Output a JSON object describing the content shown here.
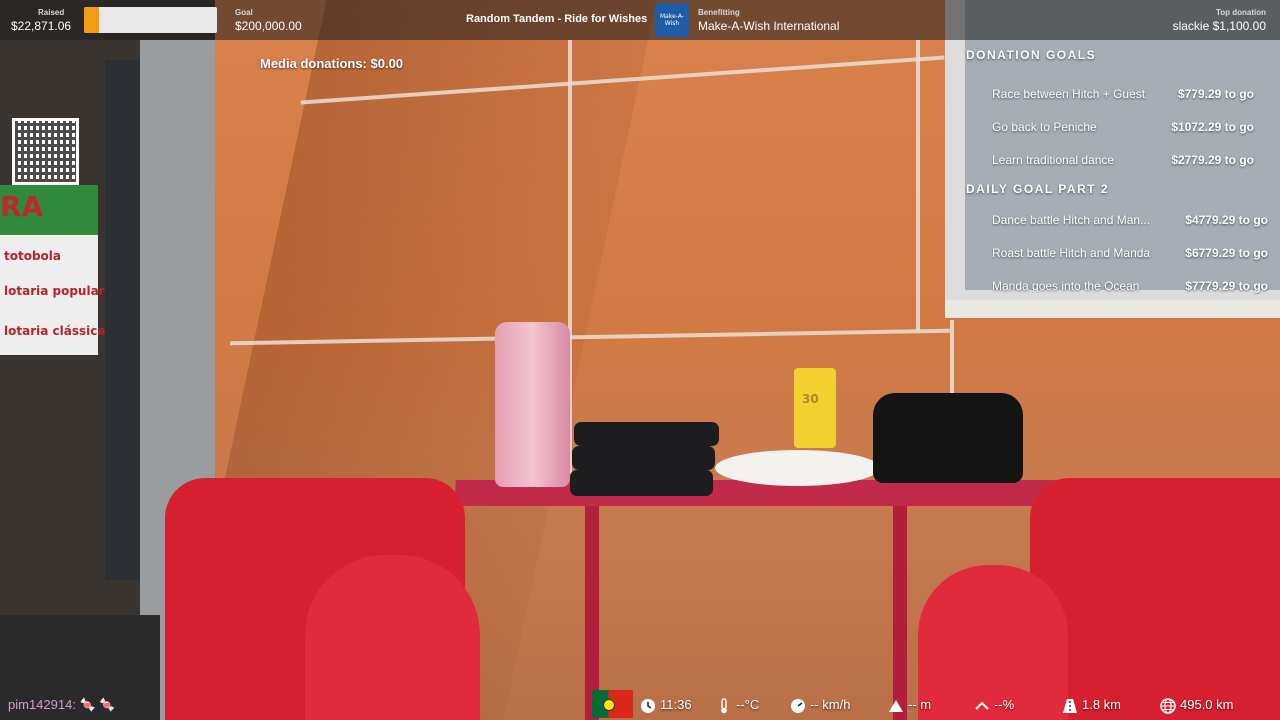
{
  "topbar": {
    "raised_label": "Raised",
    "raised_value": "$22,871.06",
    "raised_progress": 0.114,
    "goal_label": "Goal",
    "goal_value": "$200,000.00",
    "title": "Random Tandem - Ride for Wishes",
    "benefitting_label": "Benefitting",
    "benefitting_value": "Make-A-Wish International",
    "logo_text": "Make-A-Wish",
    "top_donation_label": "Top donation",
    "top_donation_value": "slackie $1,100.00",
    "progress_color": "#f39c12"
  },
  "media_donations": "Media donations: $0.00",
  "donation_goals": {
    "heading": "DONATION GOALS",
    "items": [
      {
        "label": "Race between Hitch + Guest",
        "amount": "$779.29 to go"
      },
      {
        "label": "Go back to Peniche",
        "amount": "$1072.29 to go"
      },
      {
        "label": "Learn traditional dance",
        "amount": "$2779.29 to go"
      }
    ]
  },
  "daily_goals": {
    "heading": "DAILY GOAL PART 2",
    "items": [
      {
        "label": "Dance battle Hitch and Man...",
        "amount": "$4779.29 to go"
      },
      {
        "label": "Roast battle Hitch and Manda",
        "amount": "$6779.29 to go"
      },
      {
        "label": "Manda goes into the Ocean",
        "amount": "$7779.29 to go"
      }
    ]
  },
  "chat": {
    "message": "pim142914: 🍬 🍬"
  },
  "statusbar": {
    "time": "11:36",
    "temperature": "--°C",
    "speed": "-- km/h",
    "altitude": "-- m",
    "incline": "--%",
    "distance": "1.8 km",
    "total_distance": "495.0 km"
  },
  "scene": {
    "ad_brand": "RA",
    "ad_lines": [
      "totobola",
      "lotaria popular",
      "lotaria clássica"
    ],
    "sunscreen_label": "30"
  }
}
